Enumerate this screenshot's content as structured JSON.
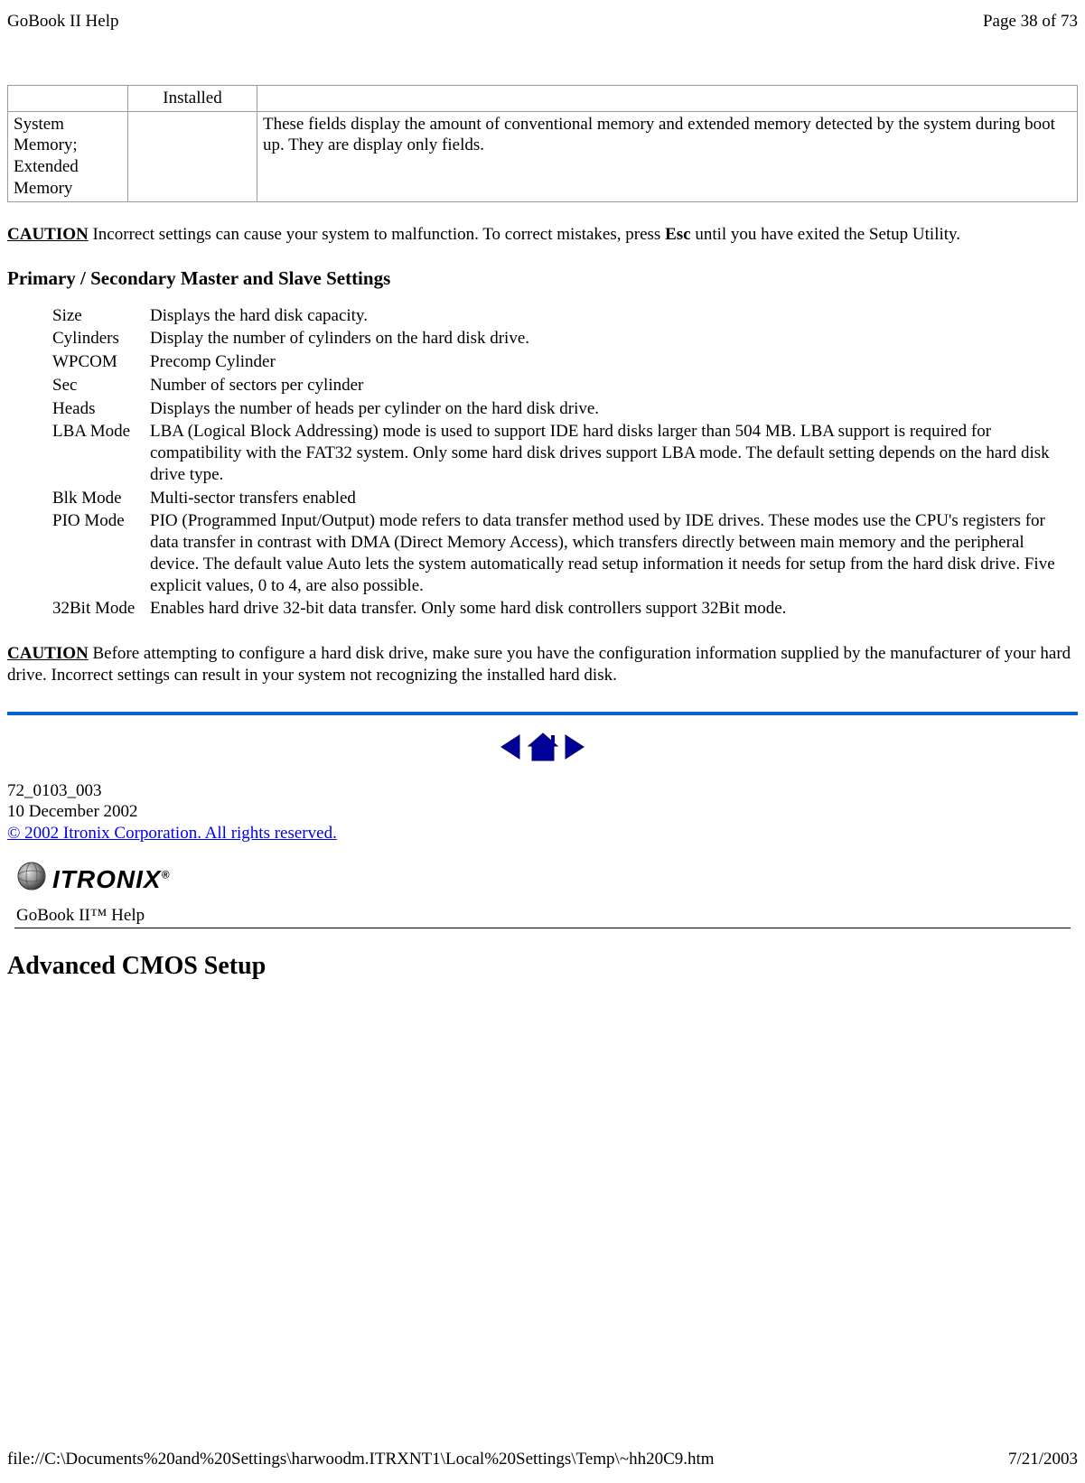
{
  "header": {
    "title": "GoBook II Help",
    "page_indicator": "Page 38 of 73"
  },
  "fields_table": {
    "row1": {
      "c1": "",
      "c2": "Installed",
      "c3": ""
    },
    "row2": {
      "c1": "System Memory; Extended Memory",
      "c2": "",
      "c3": "These fields display the amount of conventional memory and extended memory detected by the system during boot up. They are display only fields."
    }
  },
  "caution1": {
    "label": "CAUTION",
    "text": "  Incorrect settings can cause your system to malfunction.  To correct mistakes, press ",
    "key": "Esc",
    "text2": " until you have exited the Setup Utility."
  },
  "section_heading": "Primary / Secondary Master and Slave Settings",
  "settings": {
    "size": {
      "k": "Size",
      "v": "Displays the hard disk capacity."
    },
    "cylinders": {
      "k": "Cylinders",
      "v": "Display the number of cylinders on the hard disk drive."
    },
    "wpcom": {
      "k": "WPCOM",
      "v": "Precomp Cylinder"
    },
    "sec": {
      "k": "Sec",
      "v": "Number of sectors per cylinder"
    },
    "heads": {
      "k": "Heads",
      "v": "Displays the number of heads per cylinder on the hard disk drive."
    },
    "lba": {
      "k": "LBA Mode",
      "v": "LBA (Logical Block Addressing) mode is used to support IDE hard disks larger than 504 MB.  LBA support is required for compatibility with the FAT32 system.  Only some hard disk drives support LBA mode.  The default setting depends on the hard disk drive type."
    },
    "blk": {
      "k": "Blk Mode",
      "v": "Multi-sector transfers enabled"
    },
    "pio": {
      "k": "PIO Mode",
      "v": "PIO (Programmed Input/Output) mode refers to data transfer method used by IDE drives.  These modes use the CPU's registers for data transfer in contrast with DMA (Direct Memory Access), which transfers directly between main memory and the peripheral device.  The default value Auto lets the system automatically read setup information it needs for setup from the hard disk drive.  Five explicit values, 0 to 4, are also possible."
    },
    "bit32": {
      "k": "32Bit Mode",
      "v": "Enables hard drive 32-bit data transfer.  Only some hard disk controllers support 32Bit mode."
    }
  },
  "caution2": {
    "label": "CAUTION",
    "text": "  Before attempting to configure a hard disk drive, make sure you have the configuration information supplied by the manufacturer of your hard drive.  Incorrect settings can result in your system not recognizing the installed hard disk."
  },
  "doc": {
    "id": "72_0103_003",
    "date": "10 December 2002",
    "copyright": "© 2002 Itronix Corporation.  All rights reserved."
  },
  "logo": {
    "brand": "ITRONIX",
    "reg": "®"
  },
  "product_line": "GoBook II™ Help",
  "advanced_heading": "Advanced CMOS Setup",
  "footer": {
    "path": "file://C:\\Documents%20and%20Settings\\harwoodm.ITRXNT1\\Local%20Settings\\Temp\\~hh20C9.htm",
    "date": "7/21/2003"
  }
}
